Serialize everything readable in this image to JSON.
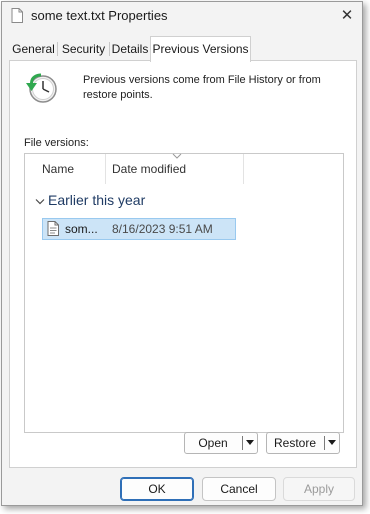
{
  "window": {
    "title": "some text.txt Properties",
    "close_glyph": "✕"
  },
  "tabs": [
    {
      "label": "General"
    },
    {
      "label": "Security"
    },
    {
      "label": "Details"
    },
    {
      "label": "Previous Versions",
      "selected": true
    }
  ],
  "info": {
    "icon": "restore-clock-icon",
    "text": "Previous versions come from File History or from restore points."
  },
  "file_versions": {
    "label": "File versions:",
    "columns": [
      {
        "label": "Name"
      },
      {
        "label": "Date modified"
      }
    ],
    "groups": [
      {
        "label": "Earlier this year",
        "items": [
          {
            "name": "som...",
            "date_modified": "8/16/2023 9:51 AM",
            "icon": "text-file-icon",
            "selected": true
          }
        ]
      }
    ]
  },
  "actions": {
    "open": "Open",
    "restore": "Restore"
  },
  "footer": {
    "ok": "OK",
    "cancel": "Cancel",
    "apply": "Apply"
  },
  "colors": {
    "accent": "#2f6fb7",
    "selection": "#cce4f7",
    "group_header": "#1f3b64"
  }
}
